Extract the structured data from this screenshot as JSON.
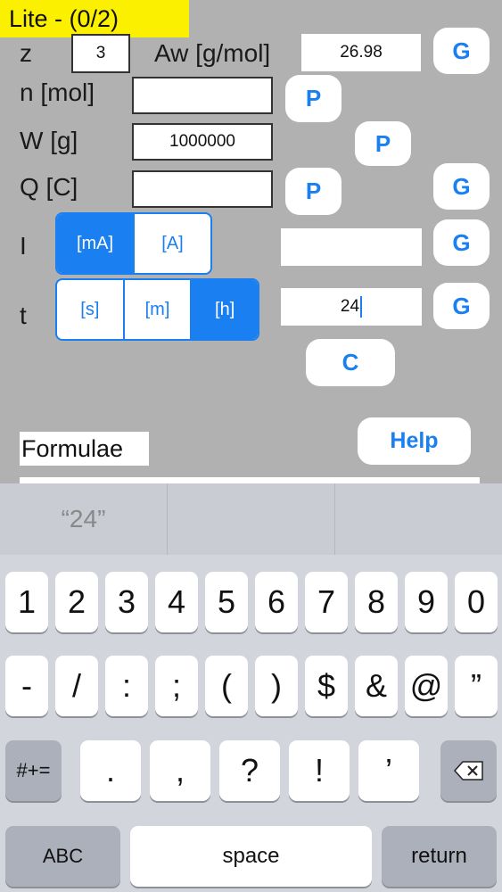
{
  "header": {
    "badge": "Lite - (0/2)"
  },
  "form": {
    "z_label": "z",
    "z_value": "3",
    "aw_label": "Aw [g/mol]",
    "aw_value": "26.98",
    "n_label": "n  [mol]",
    "n_value": "",
    "w_label": "W [g]",
    "w_value": "1000000",
    "q_label": "Q [C]",
    "q_value": "",
    "i_label": "I",
    "i_value": "",
    "t_label": "t",
    "t_value": "24",
    "g_label": "G",
    "p_label": "P",
    "c_label": "C",
    "help_label": "Help",
    "formulae_label": "Formulae"
  },
  "current_units": {
    "options": [
      "[mA]",
      "[A]"
    ],
    "selected": "[mA]"
  },
  "time_units": {
    "options": [
      "[s]",
      "[m]",
      "[h]"
    ],
    "selected": "[h]"
  },
  "keyboard": {
    "suggestions": [
      "“24”",
      "",
      ""
    ],
    "row1": [
      "1",
      "2",
      "3",
      "4",
      "5",
      "6",
      "7",
      "8",
      "9",
      "0"
    ],
    "row2": [
      "-",
      "/",
      ":",
      ";",
      "(",
      ")",
      "$",
      "&",
      "@",
      "”"
    ],
    "row3": [
      ".",
      ",",
      "?",
      "!",
      "’"
    ],
    "symbols_key": "#+=",
    "abc_key": "ABC",
    "space_key": "space",
    "return_key": "return"
  },
  "colors": {
    "accent": "#1a7ff0",
    "badge": "#fbf000",
    "background": "#b1b1b1"
  }
}
